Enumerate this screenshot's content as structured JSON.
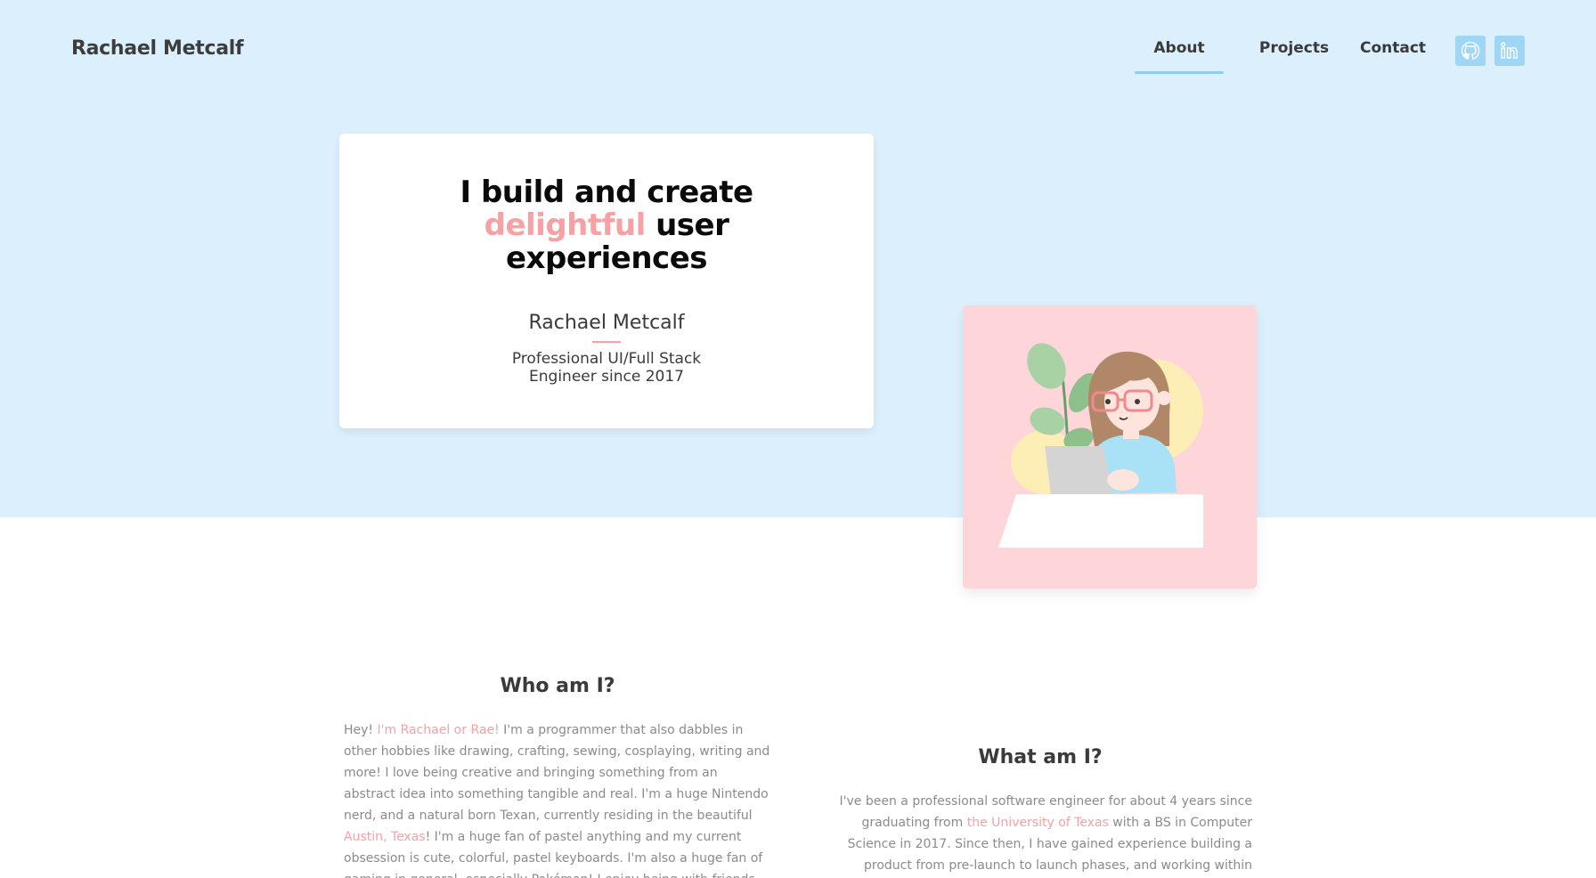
{
  "header": {
    "brand": "Rachael Metcalf",
    "nav": {
      "about": "About",
      "projects": "Projects",
      "contact": "Contact"
    },
    "social": [
      "github-icon",
      "linkedin-icon"
    ]
  },
  "hero": {
    "headline_1": "I build and create",
    "headline_accent": "delightful",
    "headline_2": " user",
    "headline_3": "experiences",
    "name": "Rachael Metcalf",
    "role_line_1": "Professional UI/Full Stack",
    "role_line_2": "Engineer since 2017",
    "avatar_icon": "girl-at-laptop-illustration"
  },
  "about": {
    "who": {
      "title": "Who am I?",
      "p1": "Hey! ",
      "link1": "I'm Rachael or Rae!",
      "p2": " I'm a programmer that also dabbles in other hobbies like drawing, crafting, sewing, cosplaying, writing and more! I love being creative and bringing something from an abstract idea into something tangible and real. I'm a huge Nintendo nerd, and a natural born Texan, currently residing in the beautiful ",
      "link2": "Austin, Texas",
      "p3": "! I'm a huge fan of pastel anything and my current obsession is cute, colorful, pastel keyboards. I'm also a huge fan of gaming in general, especially Pokémon! I enjoy being with friends either online or in person (when that was a"
    },
    "what": {
      "title": "What am I?",
      "p1": "I've been a professional software engineer for about 4 years since graduating from ",
      "link1": "the University of Texas",
      "p2": " with a BS in Computer Science in 2017. Since then, I have gained experience building a product from pre-launch to launch phases, and working within teams and ecosystems big"
    }
  },
  "colors": {
    "hero_bg": "#dbf0fc",
    "accent_pink": "#f7a1a5",
    "nav_underline": "#8ecdf0",
    "social_bg": "#9fd6f5",
    "avatar_bg": "#fed6da"
  }
}
